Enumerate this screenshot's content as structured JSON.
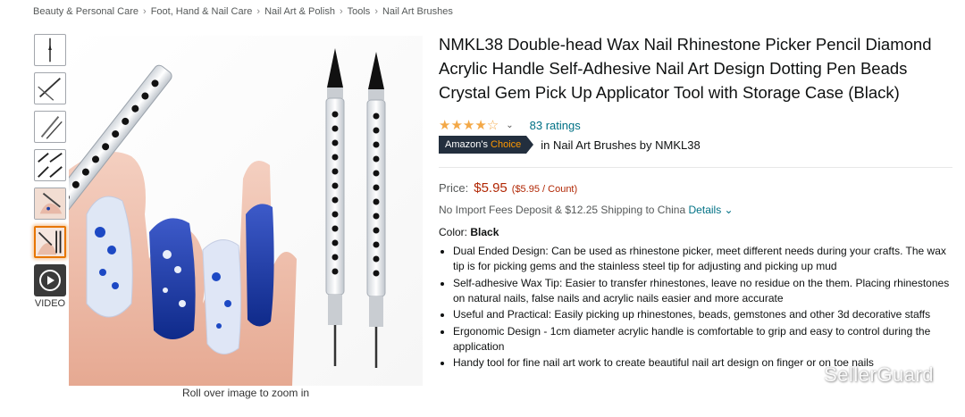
{
  "breadcrumb": [
    "Beauty & Personal Care",
    "Foot, Hand & Nail Care",
    "Nail Art & Polish",
    "Tools",
    "Nail Art Brushes"
  ],
  "breadcrumb_sep": "›",
  "thumbnails": [
    "thumb-1",
    "thumb-2",
    "thumb-3",
    "thumb-4",
    "thumb-5",
    "thumb-6"
  ],
  "video_label": "VIDEO",
  "zoom_hint": "Roll over image to zoom in",
  "product": {
    "title": "NMKL38 Double-head Wax Nail Rhinestone Picker Pencil Diamond Acrylic Handle Self-Adhesive Nail Art Design Dotting Pen Beads Crystal Gem Pick Up Applicator Tool with Storage Case (Black)",
    "stars": "★★★★☆",
    "rating_value": 4,
    "ratings_count": "83 ratings",
    "badge_prefix": "Amazon's",
    "badge_suffix": "Choice",
    "choice_in": "in Nail Art Brushes by NMKL38",
    "price_label": "Price:",
    "price": "$5.95",
    "unit_price": "($5.95 / Count)",
    "import_text": "No Import Fees Deposit & $12.25 Shipping to China",
    "details_link": "Details",
    "color_label": "Color:",
    "color_value": "Black",
    "bullets": [
      "Dual Ended Design: Can be used as rhinestone picker, meet different needs during your crafts. The wax tip is for picking gems and the stainless steel tip for adjusting and picking up mud",
      "Self-adhesive Wax Tip: Easier to transfer rhinestones, leave no residue on the them. Placing rhinestones on natural nails, false nails and acrylic nails easier and more accurate",
      "Useful and Practical: Easily picking up rhinestones, beads, gemstones and other 3d decorative staffs",
      "Ergonomic Design - 1cm diameter acrylic handle is comfortable to grip and easy to control during the application",
      "Handy tool for fine nail art work to create beautiful nail art design on finger or on toe nails"
    ]
  },
  "watermark": "SellerGuard",
  "colors": {
    "link": "#007185",
    "price": "#b12704",
    "star": "#f3a847",
    "badge_bg": "#232f3e",
    "badge_accent": "#ff9900"
  }
}
